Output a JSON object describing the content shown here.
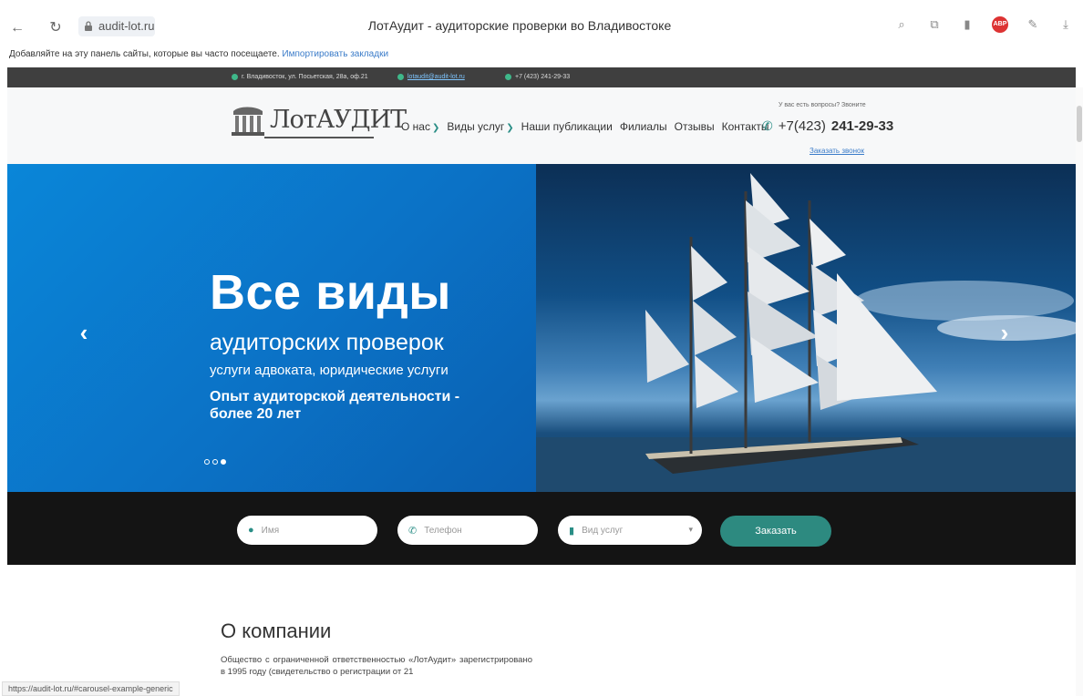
{
  "browser": {
    "address": "audit-lot.ru",
    "tab_title": "ЛотАудит - аудиторские проверки во Владивостоке",
    "bookmarks_hint": "Добавляйте на эту панель сайты, которые вы часто посещаете.",
    "bookmarks_link": "Импортировать закладки",
    "status_url": "https://audit-lot.ru/#carousel-example-generic",
    "icons": [
      "back-icon",
      "reload-icon",
      "lock-icon",
      "search-icon",
      "translate-icon",
      "bookmark-icon",
      "adblock-icon",
      "extensions-icon",
      "download-icon"
    ]
  },
  "top_strip": {
    "address": "г. Владивосток, ул. Посьетская, 28а, оф.21",
    "email": "lotaudit@audit-lot.ru",
    "phone": "+7 (423) 241-29-33"
  },
  "header": {
    "logo_text": "ЛотАУДИТ",
    "nav": [
      {
        "label": "О нас",
        "has_dropdown": true
      },
      {
        "label": "Виды услуг",
        "has_dropdown": true
      },
      {
        "label": "Наши публикации",
        "has_dropdown": false
      },
      {
        "label": "Филиалы",
        "has_dropdown": false
      },
      {
        "label": "Отзывы",
        "has_dropdown": false
      },
      {
        "label": "Контакты",
        "has_dropdown": false
      }
    ],
    "question_text": "У вас есть вопросы? Звоните",
    "phone_prefix": "+7(423)",
    "phone_number": "241-29-33",
    "callback": "Заказать звонок"
  },
  "hero": {
    "h1": "Все виды",
    "h2": "аудиторских проверок",
    "h3": "услуги адвоката, юридические услуги",
    "h4": "Опыт аудиторской деятельности - более 20 лет",
    "prev": "‹",
    "next": "›",
    "slides_total": 3,
    "active_slide": 3
  },
  "order_form": {
    "name_placeholder": "Имя",
    "phone_placeholder": "Телефон",
    "service_placeholder": "Вид услуг",
    "submit": "Заказать"
  },
  "about": {
    "title": "О компании",
    "text": "Общество с ограниченной ответственностью «ЛотАудит» зарегистрировано в 1995 году (свидетельство о регистрации от 21"
  },
  "colors": {
    "accent": "#2d8a80",
    "hero_blue": "#0b72c6",
    "top_strip": "#3f3f3f",
    "order_band": "#141414"
  }
}
